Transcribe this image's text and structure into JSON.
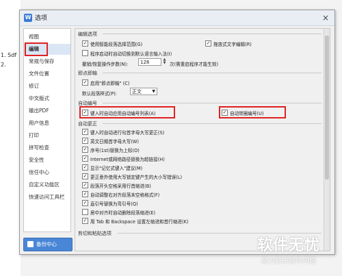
{
  "document": {
    "lines": [
      "1.  Sdf",
      "2."
    ]
  },
  "dialog": {
    "title": "选项",
    "app_icon": "W",
    "close_label": "×"
  },
  "sidebar": {
    "items": [
      {
        "label": "视图"
      },
      {
        "label": "编辑",
        "active": true
      },
      {
        "label": "常规与保存"
      },
      {
        "label": "文件位置"
      },
      {
        "label": "修订"
      },
      {
        "label": "中文版式"
      },
      {
        "label": "输出PDF"
      },
      {
        "label": "用户信息"
      },
      {
        "label": "打印"
      },
      {
        "label": "拼写检查"
      },
      {
        "label": "安全性"
      },
      {
        "label": "信任中心"
      },
      {
        "label": "自定义功能区"
      },
      {
        "label": "快速访问工具栏"
      }
    ],
    "backup_button": "备份中心"
  },
  "content": {
    "sections": {
      "edit_options": "编辑选项",
      "clip": "即点即输",
      "auto_number": "自动编号",
      "auto_correct": "自动更正",
      "cut_paste": "剪切和粘贴选项"
    },
    "edit_options": {
      "smart_select": {
        "label": "使用智能段落选择范围(G)",
        "checked": true
      },
      "drag_edit": {
        "label": "拖放式文字编辑(R)",
        "checked": true
      },
      "ime_switch": {
        "label": "程序启动时自动切换到默认语言输入法(I)",
        "checked": false
      },
      "undo_steps_label": "撤销/恢复操作步数(N):",
      "undo_steps_value": "128",
      "undo_steps_suffix": "次(需重启程序才能生效)"
    },
    "click_type": {
      "enable": {
        "label": "启用\"即点即输\" (C)",
        "checked": true
      },
      "style_label": "默认段落样式(P):",
      "style_value": "正文"
    },
    "auto_number": {
      "auto_list": {
        "label": "键入时自动应用自动编号列表(A)",
        "checked": true
      },
      "auto_circle": {
        "label": "自动带圈编号(U)",
        "checked": true
      }
    },
    "auto_correct": [
      {
        "label": "键入时自动进行句首字母大写更正(S)",
        "checked": true
      },
      {
        "label": "英文日期首字母大写(W)",
        "checked": true
      },
      {
        "label": "序号(1st)替换为上标(O)",
        "checked": true
      },
      {
        "label": "Internet或网络路径替换为超链接(H)",
        "checked": true
      },
      {
        "label": "显示\"记忆式键入\"建议(M)",
        "checked": true
      },
      {
        "label": "更正意外使用大写锁定键产生的大小写错误(L)",
        "checked": true
      },
      {
        "label": "段落开头空格采用行首缩进(B)",
        "checked": true
      },
      {
        "label": "自动调整右对齐段落末空格格式(F)",
        "checked": true
      },
      {
        "label": "直引号替换为弯引号(Q)",
        "checked": true
      },
      {
        "label": "居中对齐时自动删除段落缩进(E)",
        "checked": false
      },
      {
        "label": "用 Tab 和 Backspace 设置左缩进和首行缩进(K)",
        "checked": true
      }
    ]
  },
  "watermark": {
    "title": "软件无忧",
    "subtitle": "努力解决软件问题"
  },
  "colors": {
    "highlight_red": "#e02020",
    "backup_blue": "#4a86d6",
    "active_bg": "#dbe6f5"
  }
}
